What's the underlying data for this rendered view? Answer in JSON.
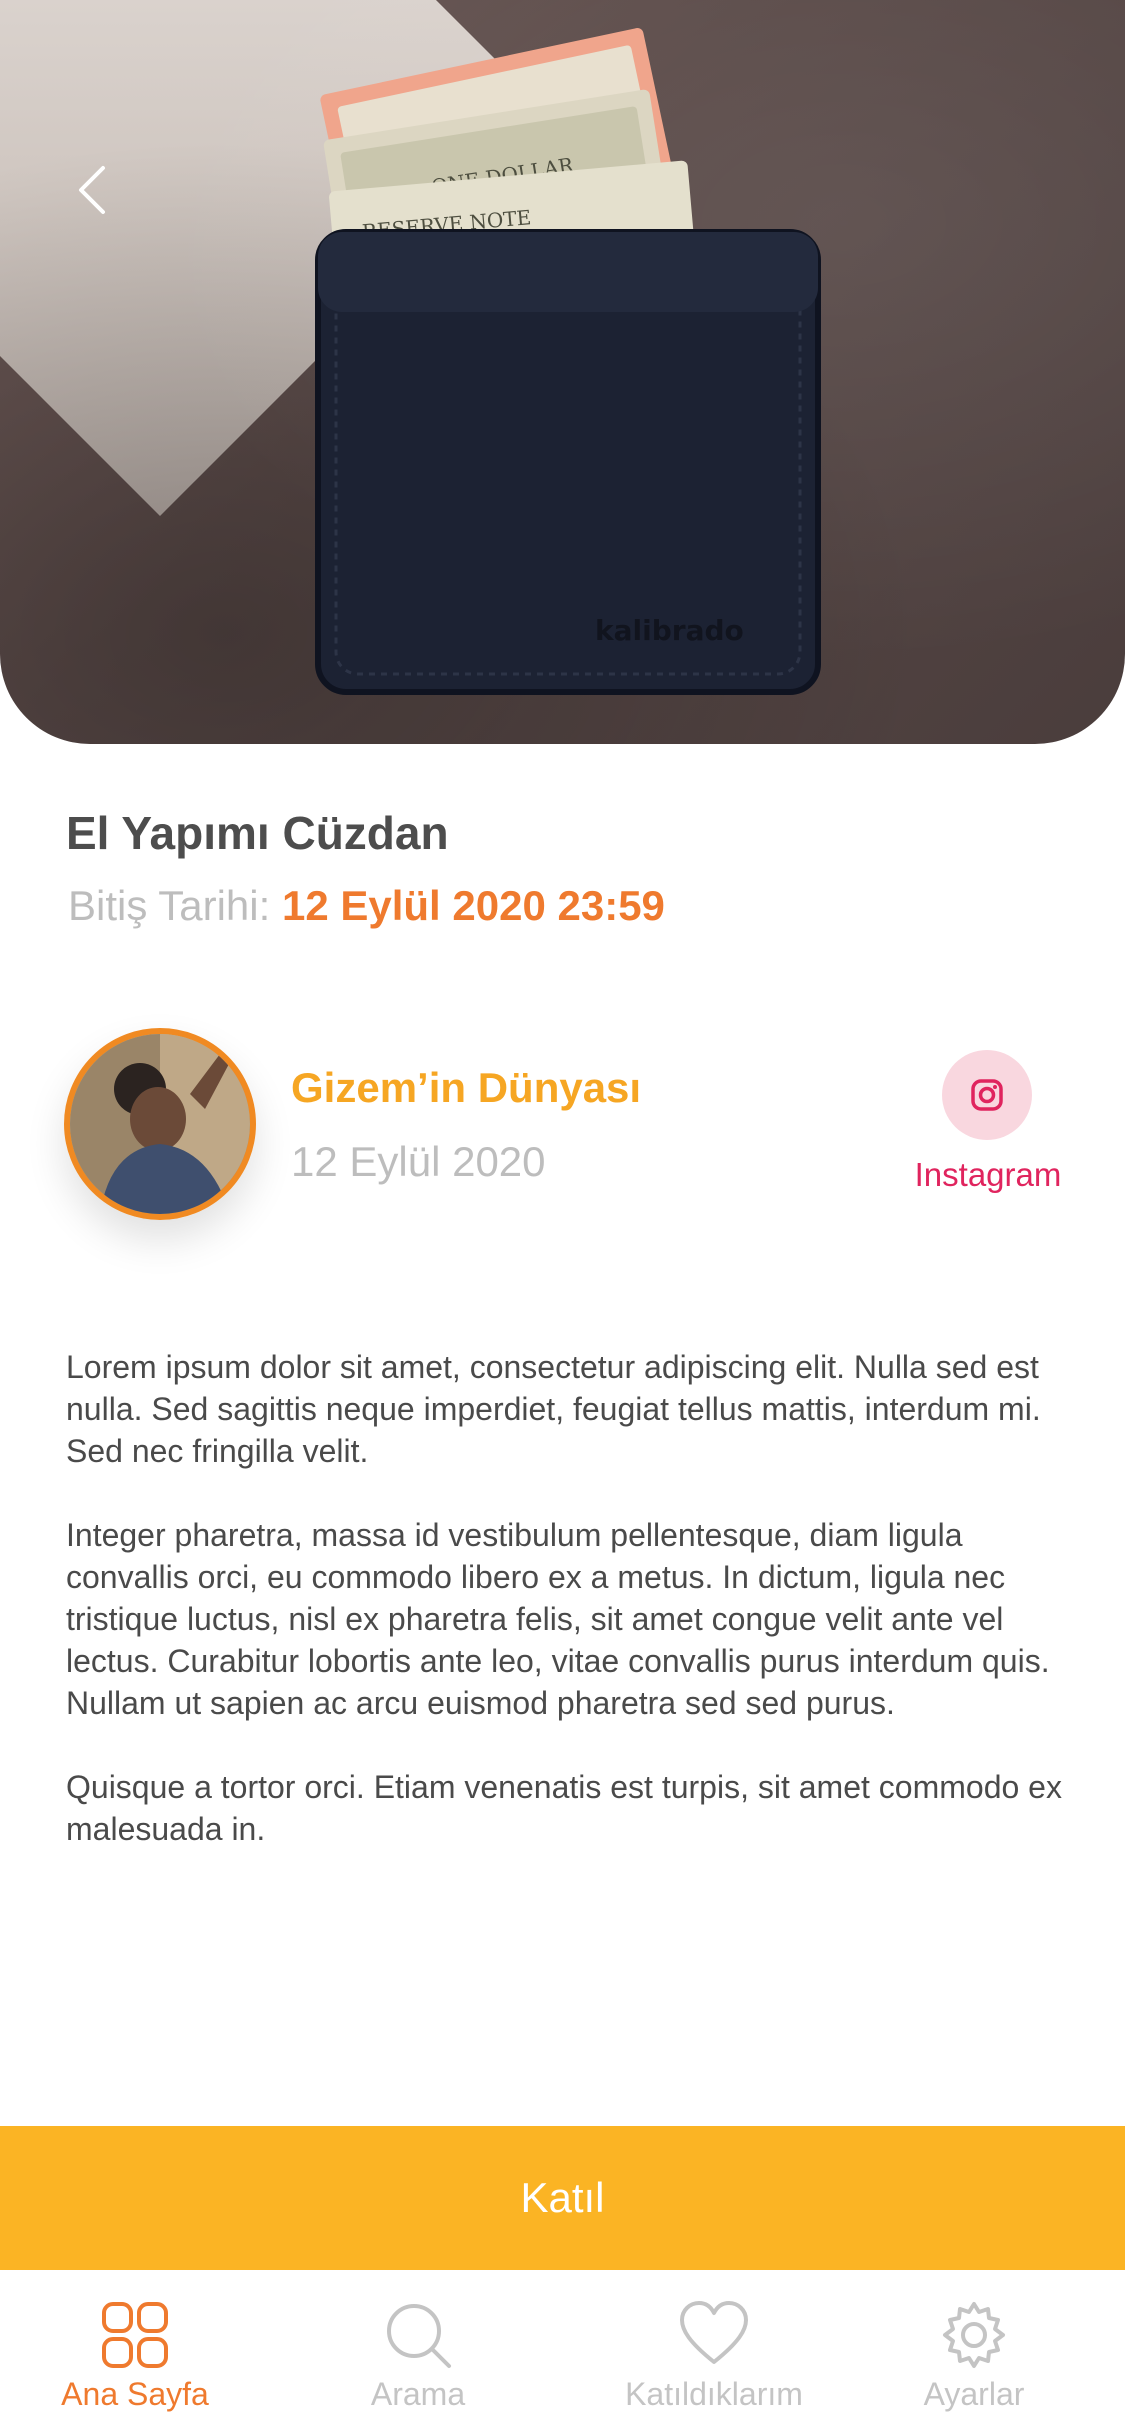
{
  "hero": {
    "image_description_icon": "wallet-photo",
    "back_icon": "chevron-left-icon"
  },
  "product": {
    "title": "El Yapımı Cüzdan",
    "deadline_label": "Bitiş Tarihi:",
    "deadline_value": "12 Eylül 2020 23:59"
  },
  "author": {
    "name": "Gizem’in Dünyası",
    "date": "12 Eylül 2020",
    "social_label": "Instagram",
    "social_icon": "instagram-icon"
  },
  "description": {
    "paragraphs": [
      "Lorem ipsum dolor sit amet, consectetur adipiscing elit. Nulla sed est nulla. Sed sagittis neque imperdiet, feugiat tellus mattis, interdum mi. Sed nec fringilla velit.",
      "Integer pharetra, massa id vestibulum pellentesque, diam ligula convallis orci, eu commodo libero ex a metus. In dictum, ligula nec tristique luctus, nisl ex pharetra felis, sit amet congue velit ante vel lectus. Curabitur lobortis ante leo, vitae convallis purus interdum quis. Nullam ut sapien ac arcu euismod pharetra sed sed purus.",
      "Quisque a tortor orci. Etiam venenatis est turpis, sit amet commodo ex malesuada in."
    ]
  },
  "actions": {
    "join_label": "Katıl"
  },
  "tabbar": {
    "items": [
      {
        "label": "Ana Sayfa",
        "icon": "grid-icon",
        "active": true
      },
      {
        "label": "Arama",
        "icon": "search-icon",
        "active": false
      },
      {
        "label": "Katıldıklarım",
        "icon": "heart-icon",
        "active": false
      },
      {
        "label": "Ayarlar",
        "icon": "gear-icon",
        "active": false
      }
    ]
  },
  "colors": {
    "accent_orange": "#ef7a2e",
    "author_yellow": "#f6a623",
    "join_button": "#fbb424",
    "instagram_pink": "#e0245e",
    "muted_gray": "#bdbdbd"
  }
}
